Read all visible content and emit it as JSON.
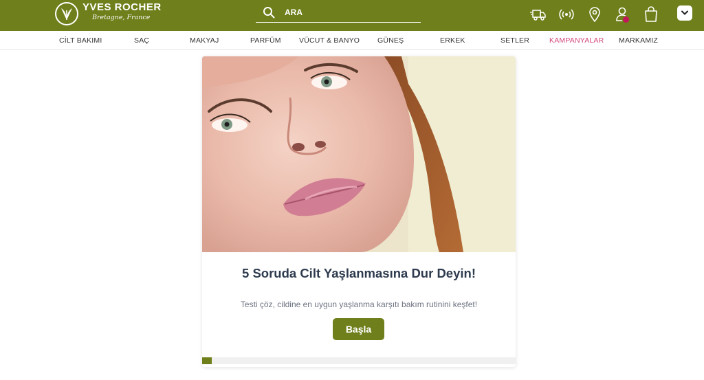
{
  "brand": {
    "name": "YVES ROCHER",
    "tagline": "Bretagne, France"
  },
  "search": {
    "placeholder": "ARA"
  },
  "header_icons": [
    "delivery-truck-icon",
    "broadcast-icon",
    "location-pin-icon",
    "user-icon",
    "shopping-bag-icon",
    "chevron-down-icon"
  ],
  "nav": {
    "items": [
      "CİLT BAKIMI",
      "SAÇ",
      "MAKYAJ",
      "PARFÜM",
      "VÜCUT & BANYO",
      "GÜNEŞ",
      "ERKEK",
      "SETLER",
      "KAMPANYALAR",
      "MARKAMIZ"
    ]
  },
  "quiz": {
    "title": "5 Soruda Cilt Yaşlanmasına Dur Deyin!",
    "description": "Testi çöz, cildine en uygun yaşlanma karşıtı bakım rutinini keşfet!",
    "start_label": "Başla",
    "progress": 0.03
  },
  "colors": {
    "brand_green": "#6f7f1b",
    "promo_pink": "#d2457a",
    "badge": "#c2185b",
    "title_text": "#2e3b4e"
  }
}
